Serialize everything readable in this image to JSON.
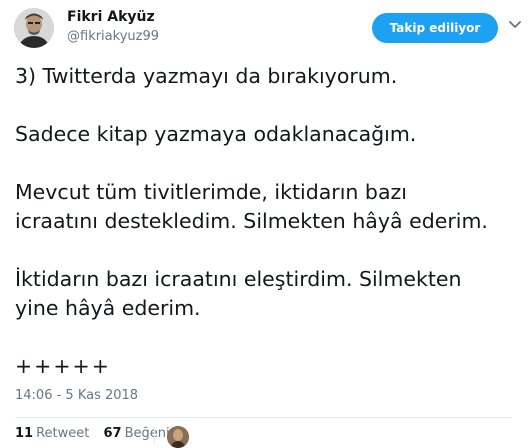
{
  "author": {
    "display_name": "Fikri Akyüz",
    "handle": "@fikriakyuz99",
    "avatar_icon": "profile-photo"
  },
  "follow_button": {
    "label": "Takip ediliyor",
    "color": "#1da1f2"
  },
  "menu_icon": "chevron-down-icon",
  "tweet": {
    "lines": [
      "3) Twitterda yazmayı da bırakıyorum.",
      "Sadece kitap yazmaya odaklanacağım.",
      "Mevcut tüm tivitlerimde, iktidarın bazı\nicraatını destekledim. Silmekten hâyâ ederim.",
      "İktidarın bazı icraatını eleştirdim. Silmekten\nyine hâyâ ederim.",
      "+++++"
    ]
  },
  "timestamp": "14:06 - 5 Kas 2018",
  "stats": {
    "retweets_count": "11",
    "retweets_label": "Retweet",
    "likes_count": "67",
    "likes_label": "Beğeni"
  },
  "colors": {
    "text": "#14171a",
    "muted": "#657786",
    "accent": "#1da1f2"
  }
}
